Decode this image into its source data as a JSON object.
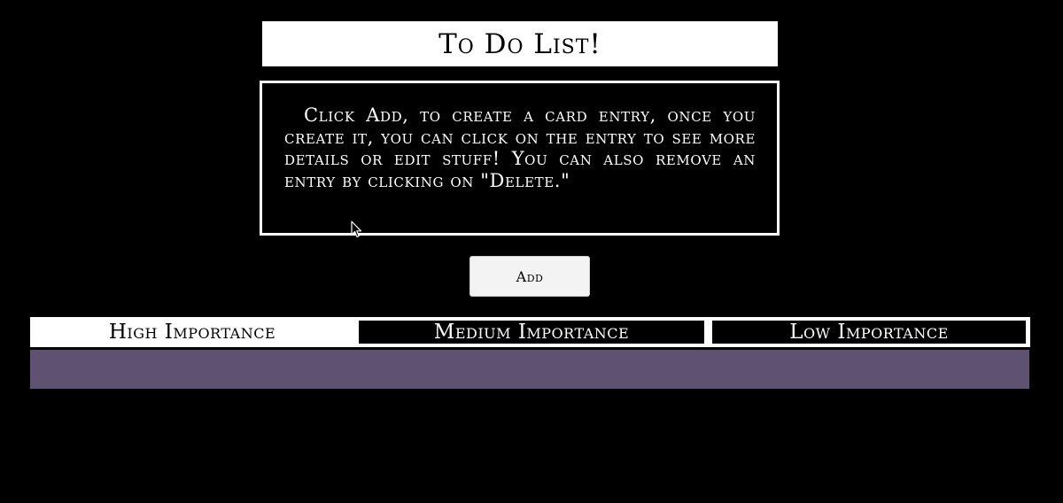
{
  "header": {
    "title": "To Do List!"
  },
  "instructions": {
    "text": "Click Add, to create a card entry, once you create it, you can click on the entry to see more details or edit stuff! You can also remove an entry by clicking on \"Delete.\""
  },
  "toolbar": {
    "add_label": "Add"
  },
  "tabs": [
    {
      "label": "High Importance",
      "active": true
    },
    {
      "label": "Medium Importance",
      "active": false
    },
    {
      "label": "Low Importance",
      "active": false
    }
  ],
  "colors": {
    "background": "#000000",
    "card_area": "#5f5172",
    "button": "#f3f3f3"
  },
  "icons": {
    "cursor": "mouse-pointer-icon"
  }
}
